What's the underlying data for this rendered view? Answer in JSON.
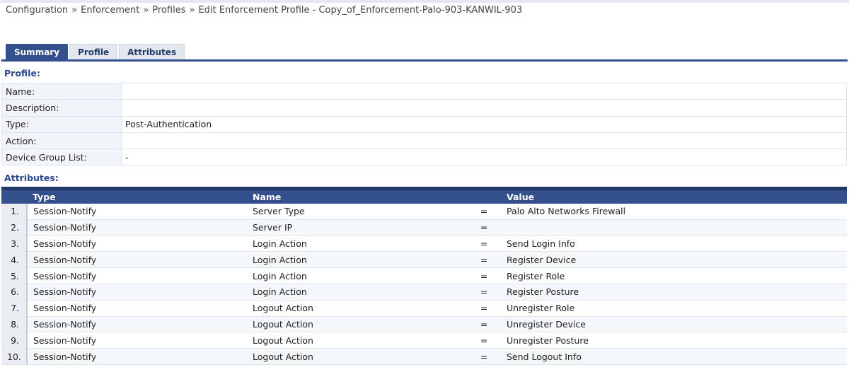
{
  "breadcrumb": {
    "items": [
      "Configuration",
      "Enforcement",
      "Profiles",
      "Edit Enforcement Profile - Copy_of_Enforcement-Palo-903-KANWIL-903"
    ],
    "separator": "»"
  },
  "tabs": [
    "Summary",
    "Profile",
    "Attributes"
  ],
  "active_tab": "Summary",
  "profile": {
    "section_title": "Profile:",
    "rows": [
      {
        "label": "Name:",
        "value": ""
      },
      {
        "label": "Description:",
        "value": ""
      },
      {
        "label": "Type:",
        "value": "Post-Authentication"
      },
      {
        "label": "Action:",
        "value": ""
      },
      {
        "label": "Device Group List:",
        "value": "-"
      }
    ]
  },
  "attributes": {
    "section_title": "Attributes:",
    "columns": {
      "type": "Type",
      "name": "Name",
      "value": "Value"
    },
    "rows": [
      {
        "num": "1.",
        "type": "Session-Notify",
        "name": "Server Type",
        "op": "=",
        "value": "Palo Alto Networks Firewall"
      },
      {
        "num": "2.",
        "type": "Session-Notify",
        "name": "Server IP",
        "op": "=",
        "value": ""
      },
      {
        "num": "3.",
        "type": "Session-Notify",
        "name": "Login Action",
        "op": "=",
        "value": "Send Login Info"
      },
      {
        "num": "4.",
        "type": "Session-Notify",
        "name": "Login Action",
        "op": "=",
        "value": "Register Device"
      },
      {
        "num": "5.",
        "type": "Session-Notify",
        "name": "Login Action",
        "op": "=",
        "value": "Register Role"
      },
      {
        "num": "6.",
        "type": "Session-Notify",
        "name": "Login Action",
        "op": "=",
        "value": "Register Posture"
      },
      {
        "num": "7.",
        "type": "Session-Notify",
        "name": "Logout Action",
        "op": "=",
        "value": "Unregister Role"
      },
      {
        "num": "8.",
        "type": "Session-Notify",
        "name": "Logout Action",
        "op": "=",
        "value": "Unregister Device"
      },
      {
        "num": "9.",
        "type": "Session-Notify",
        "name": "Logout Action",
        "op": "=",
        "value": "Unregister Posture"
      },
      {
        "num": "10.",
        "type": "Session-Notify",
        "name": "Logout Action",
        "op": "=",
        "value": "Send Logout Info"
      }
    ]
  },
  "colors": {
    "header_blue": "#34508c",
    "section_title": "#2b4a8e",
    "label_bg": "#f1f5f9"
  }
}
